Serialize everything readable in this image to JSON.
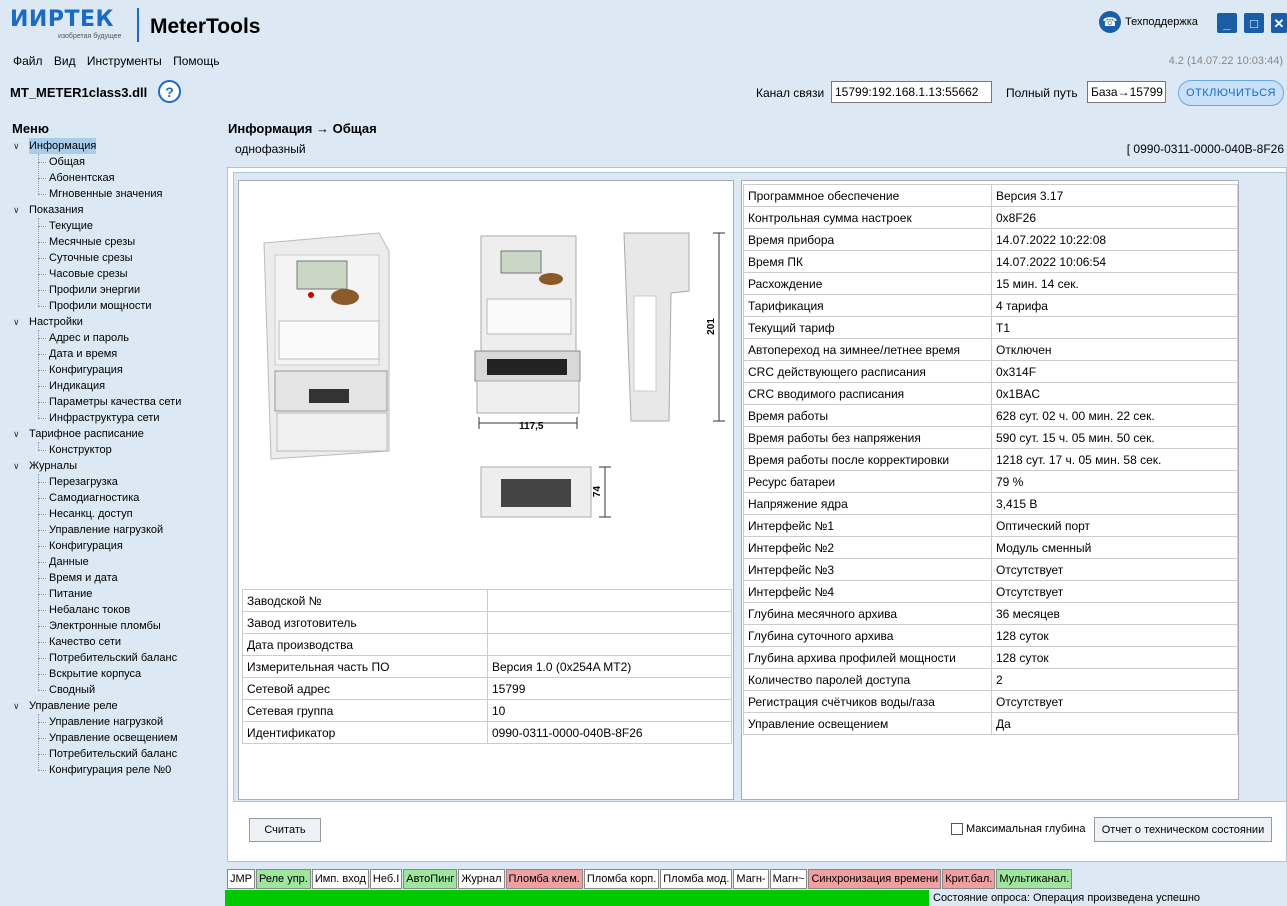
{
  "app": {
    "logo": "ИИРТЕК",
    "logo_sub": "изобретая будущее",
    "title": "MeterTools",
    "support": "Техподдержка",
    "version": "4.2 (14.07.22 10:03:44)"
  },
  "menu": {
    "items": [
      "Файл",
      "Вид",
      "Инструменты",
      "Помощь"
    ]
  },
  "toolbar": {
    "dll": "MT_METER1class3.dll",
    "channel_label": "Канал связи",
    "channel_value": "15799:192.168.1.13:55662",
    "path_label": "Полный путь",
    "path_value": "База→15799",
    "disconnect": "ОТКЛЮЧИТЬСЯ"
  },
  "tree": {
    "title": "Меню",
    "groups": [
      {
        "label": "Информация",
        "items": [
          "Общая",
          "Абонентская",
          "Мгновенные значения"
        ]
      },
      {
        "label": "Показания",
        "items": [
          "Текущие",
          "Месячные срезы",
          "Суточные срезы",
          "Часовые срезы",
          "Профили энергии",
          "Профили мощности"
        ]
      },
      {
        "label": "Настройки",
        "items": [
          "Адрес и пароль",
          "Дата и время",
          "Конфигурация",
          "Индикация",
          "Параметры качества сети",
          "Инфраструктура сети"
        ]
      },
      {
        "label": "Тарифное расписание",
        "items": [
          "Конструктор"
        ]
      },
      {
        "label": "Журналы",
        "items": [
          "Перезагрузка",
          "Самодиагностика",
          "Несанкц. доступ",
          "Управление нагрузкой",
          "Конфигурация",
          "Данные",
          "Время и дата",
          "Питание",
          "Небаланс токов",
          "Электронные пломбы",
          "Качество сети",
          "Потребительский баланс",
          "Вскрытие корпуса",
          "Сводный"
        ]
      },
      {
        "label": "Управление реле",
        "items": [
          "Управление нагрузкой",
          "Управление освещением",
          "Потребительский баланс",
          "Конфигурация реле №0"
        ]
      }
    ]
  },
  "page": {
    "breadcrumb": "Информация → Общая",
    "subtitle": "однофазный",
    "serial": "[ 0990-0311-0000-040B-8F26"
  },
  "figure": {
    "dim_width": "117,5",
    "dim_height": "201",
    "dim_depth": "74"
  },
  "left_table": [
    [
      "Заводской №",
      ""
    ],
    [
      "Завод изготовитель",
      ""
    ],
    [
      "Дата производства",
      ""
    ],
    [
      "Измерительная часть ПО",
      "Версия 1.0 (0x254A MT2)"
    ],
    [
      "Сетевой адрес",
      "15799"
    ],
    [
      "Сетевая группа",
      "10"
    ],
    [
      "Идентификатор",
      "0990-0311-0000-040B-8F26"
    ]
  ],
  "right_table": [
    [
      "Программное обеспечение",
      "Версия 3.17"
    ],
    [
      "Контрольная сумма настроек",
      "0x8F26"
    ],
    [
      "Время прибора",
      "14.07.2022 10:22:08"
    ],
    [
      "Время ПК",
      "14.07.2022 10:06:54"
    ],
    [
      "Расхождение",
      "15 мин. 14 сек."
    ],
    [
      "Тарификация",
      "4 тарифа"
    ],
    [
      "Текущий тариф",
      "T1"
    ],
    [
      "Автопереход на зимнее/летнее время",
      "Отключен"
    ],
    [
      "CRC действующего расписания",
      "0x314F"
    ],
    [
      "CRC вводимого расписания",
      "0x1BAC"
    ],
    [
      "Время работы",
      "628 сут. 02 ч. 00 мин. 22 сек."
    ],
    [
      "Время работы без напряжения",
      "590 сут. 15 ч. 05 мин. 50 сек."
    ],
    [
      "Время работы после корректировки",
      "1218 сут. 17 ч. 05 мин. 58 сек."
    ],
    [
      "Ресурс батареи",
      "79 %"
    ],
    [
      "Напряжение ядра",
      "3,415 В"
    ],
    [
      "Интерфейс №1",
      "Оптический порт"
    ],
    [
      "Интерфейс №2",
      "Модуль сменный"
    ],
    [
      "Интерфейс №3",
      "Отсутствует"
    ],
    [
      "Интерфейс №4",
      "Отсутствует"
    ],
    [
      "Глубина месячного архива",
      "36 месяцев"
    ],
    [
      "Глубина суточного архива",
      "128 суток"
    ],
    [
      "Глубина архива профилей мощности",
      "128 суток"
    ],
    [
      "Количество паролей доступа",
      "2"
    ],
    [
      "Регистрация счётчиков воды/газа",
      "Отсутствует"
    ],
    [
      "Управление освещением",
      "Да"
    ]
  ],
  "buttons": {
    "read": "Считать",
    "max_depth": "Максимальная глубина",
    "report": "Отчет о техническом состоянии"
  },
  "status_flags": [
    {
      "label": "JMP",
      "state": "none"
    },
    {
      "label": "Реле упр.",
      "state": "green"
    },
    {
      "label": "Имп. вход",
      "state": "none"
    },
    {
      "label": "Неб.I",
      "state": "none"
    },
    {
      "label": "АвтоПинг",
      "state": "green"
    },
    {
      "label": "Журнал",
      "state": "none"
    },
    {
      "label": "Пломба клем.",
      "state": "red"
    },
    {
      "label": "Пломба корп.",
      "state": "none"
    },
    {
      "label": "Пломба мод.",
      "state": "none"
    },
    {
      "label": "Магн-",
      "state": "none"
    },
    {
      "label": "Магн~",
      "state": "none"
    },
    {
      "label": "Синхронизация времени",
      "state": "red"
    },
    {
      "label": "Крит.бал.",
      "state": "red"
    },
    {
      "label": "Мультиканал.",
      "state": "green"
    }
  ],
  "poll": {
    "label": "Состояние опроса:",
    "value": "Операция произведена успешно",
    "progress": 1.0
  }
}
